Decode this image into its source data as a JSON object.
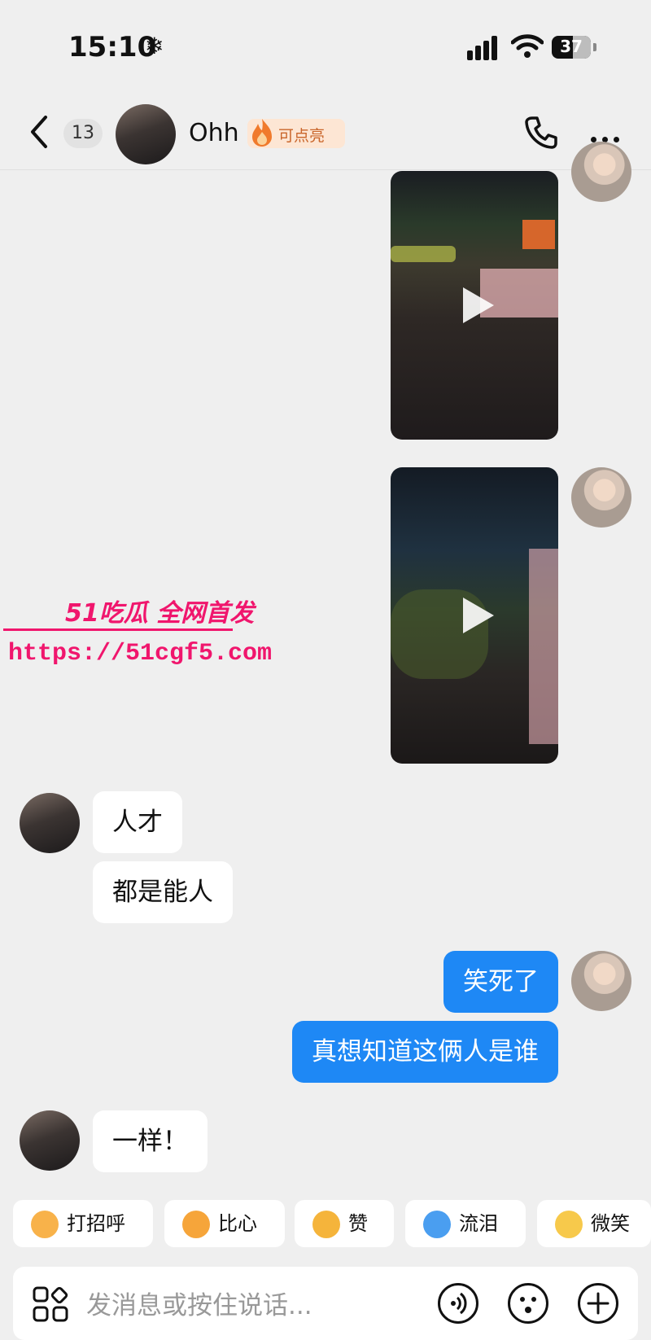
{
  "status_bar": {
    "time": "15:10",
    "snow_glyph": "❄",
    "battery": "37"
  },
  "header": {
    "unread_count": "13",
    "contact_name": "Ohh",
    "fire_badge": "可点亮"
  },
  "messages": [
    {
      "side": "in",
      "text": "人才"
    },
    {
      "side": "in",
      "text": "都是能人"
    },
    {
      "side": "out",
      "text": "笑死了"
    },
    {
      "side": "out",
      "text": "真想知道这俩人是谁"
    },
    {
      "side": "in",
      "text": "一样！"
    }
  ],
  "watermark": {
    "title": "51吃瓜 全网首发",
    "url": "https://51cgf5.com"
  },
  "quick_replies": [
    {
      "label": "打招呼",
      "icon": "wave-emoji-icon",
      "color": "#f8b24a"
    },
    {
      "label": "比心",
      "icon": "heart-hands-emoji-icon",
      "color": "#f6a53a"
    },
    {
      "label": "赞",
      "icon": "thumbs-up-emoji-icon",
      "color": "#f5b43b"
    },
    {
      "label": "流泪",
      "icon": "crying-emoji-icon",
      "color": "#4a9ef0"
    },
    {
      "label": "微笑",
      "icon": "smile-emoji-icon",
      "color": "#f7c94b"
    }
  ],
  "input": {
    "placeholder": "发消息或按住说话..."
  },
  "colors": {
    "accent": "#1e88f5",
    "background": "#efefef",
    "watermark": "#f0166d"
  }
}
